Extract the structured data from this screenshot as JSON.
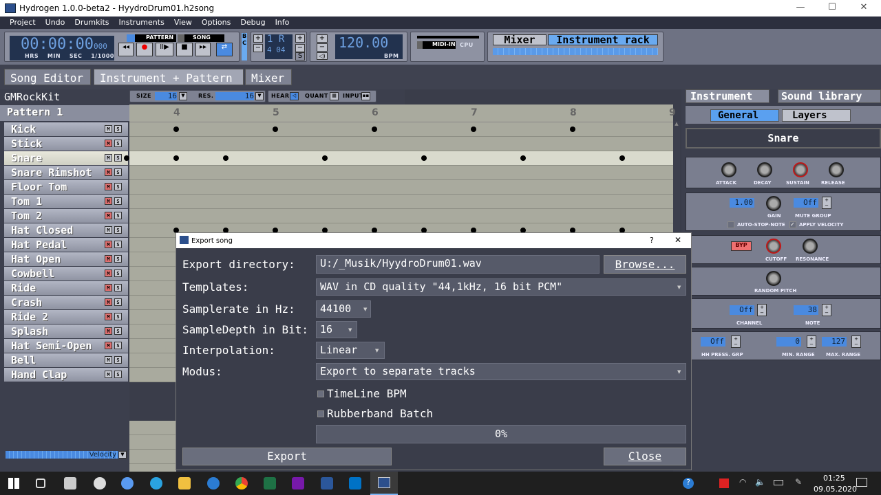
{
  "window": {
    "title": "Hydrogen 1.0.0-beta2 - HyydroDrum01.h2song",
    "minimize": "—",
    "maximize": "☐",
    "close": "✕"
  },
  "menu": [
    "Project",
    "Undo",
    "Drumkits",
    "Instruments",
    "View",
    "Options",
    "Debug",
    "Info"
  ],
  "toolbar": {
    "time": "00:00:00",
    "time_ms": "000",
    "time_labels": [
      "HRS",
      "MIN",
      "SEC",
      "1/1000"
    ],
    "mode_pattern": "PATTERN",
    "mode_song": "SONG",
    "bc": [
      "B",
      "C"
    ],
    "bar": "1",
    "beat_r": "R",
    "meter": "4 04",
    "s_label": "S",
    "bpm": "120.00",
    "bpm_label": "BPM",
    "midi_in": "MIDI-IN",
    "cpu": "CPU",
    "mixer": "Mixer",
    "instrument_rack": "Instrument rack"
  },
  "tabs": [
    "Song Editor",
    "Instrument + Pattern",
    "Mixer"
  ],
  "kit": "GMRockKit",
  "pattern": "Pattern 1",
  "pattern_toolbar": {
    "size_label": "SIZE",
    "size": "16",
    "res_label": "RES.",
    "res": "16",
    "hear": "HEAR",
    "quant": "QUANT",
    "input": "INPUT"
  },
  "ruler": [
    "4",
    "5",
    "6",
    "7",
    "8",
    "9"
  ],
  "instruments": [
    {
      "name": "Kick",
      "red": false
    },
    {
      "name": "Stick",
      "red": true
    },
    {
      "name": "Snare",
      "red": false,
      "selected": true
    },
    {
      "name": "Snare Rimshot",
      "red": true
    },
    {
      "name": "Floor Tom",
      "red": true
    },
    {
      "name": "Tom 1",
      "red": true
    },
    {
      "name": "Tom 2",
      "red": true
    },
    {
      "name": "Hat Closed",
      "red": false
    },
    {
      "name": "Hat Pedal",
      "red": true
    },
    {
      "name": "Hat Open",
      "red": true
    },
    {
      "name": "Cowbell",
      "red": true
    },
    {
      "name": "Ride",
      "red": true
    },
    {
      "name": "Crash",
      "red": true
    },
    {
      "name": "Ride 2",
      "red": true
    },
    {
      "name": "Splash",
      "red": true
    },
    {
      "name": "Hat Semi-Open",
      "red": true
    },
    {
      "name": "Bell",
      "red": false
    },
    {
      "name": "Hand Clap",
      "red": false
    }
  ],
  "mute_label": "M",
  "solo_label": "S",
  "notes": {
    "0": [
      4,
      5,
      6,
      7,
      8
    ],
    "2": [
      3.5,
      4,
      4.5,
      5.5,
      6.5,
      7.5,
      8.5
    ],
    "7": [
      4,
      4.5,
      5,
      5.5,
      6,
      6.5,
      7,
      7.5,
      8,
      8.5
    ]
  },
  "velocity": "Velocity",
  "right": {
    "tab_instrument": "Instrument",
    "tab_library": "Sound library",
    "general": "General",
    "layers": "Layers",
    "name": "Snare",
    "adsr": [
      "ATTACK",
      "DECAY",
      "SUSTAIN",
      "RELEASE"
    ],
    "gain_value": "1.00",
    "gain": "GAIN",
    "mute_group_value": "Off",
    "mute_group": "MUTE GROUP",
    "auto_stop": "AUTO-STOP-NOTE",
    "apply_velocity": "APPLY VELOCITY",
    "byp": "BYP",
    "cutoff": "CUTOFF",
    "resonance": "RESONANCE",
    "random_pitch": "RANDOM PITCH",
    "channel_value": "Off",
    "channel": "CHANNEL",
    "note_value": "38",
    "note": "NOTE",
    "hh_value": "Off",
    "hh": "HH PRESS. GRP",
    "min_value": "0",
    "min": "MIN. RANGE",
    "max_value": "127",
    "max": "MAX. RANGE"
  },
  "dialog": {
    "title": "Export song",
    "help": "?",
    "close": "✕",
    "dir_label": "Export directory:",
    "dir": "U:/_Musik/HyydroDrum01.wav",
    "browse": "Browse...",
    "templates_label": "Templates:",
    "template": "WAV in CD quality  \"44,1kHz, 16 bit PCM\"",
    "sr_label": "Samplerate in Hz:",
    "sr": "44100",
    "depth_label": "SampleDepth in Bit:",
    "depth": "16",
    "interp_label": "Interpolation:",
    "interp": "Linear",
    "modus_label": "Modus:",
    "modus": "Export to separate tracks",
    "timeline": "TimeLine BPM",
    "rubberband": "Rubberband Batch",
    "progress": "0%",
    "progress_value": 0,
    "export": "Export",
    "close_btn": "Close"
  },
  "taskbar": {
    "time": "01:25",
    "date": "09.05.2020"
  }
}
